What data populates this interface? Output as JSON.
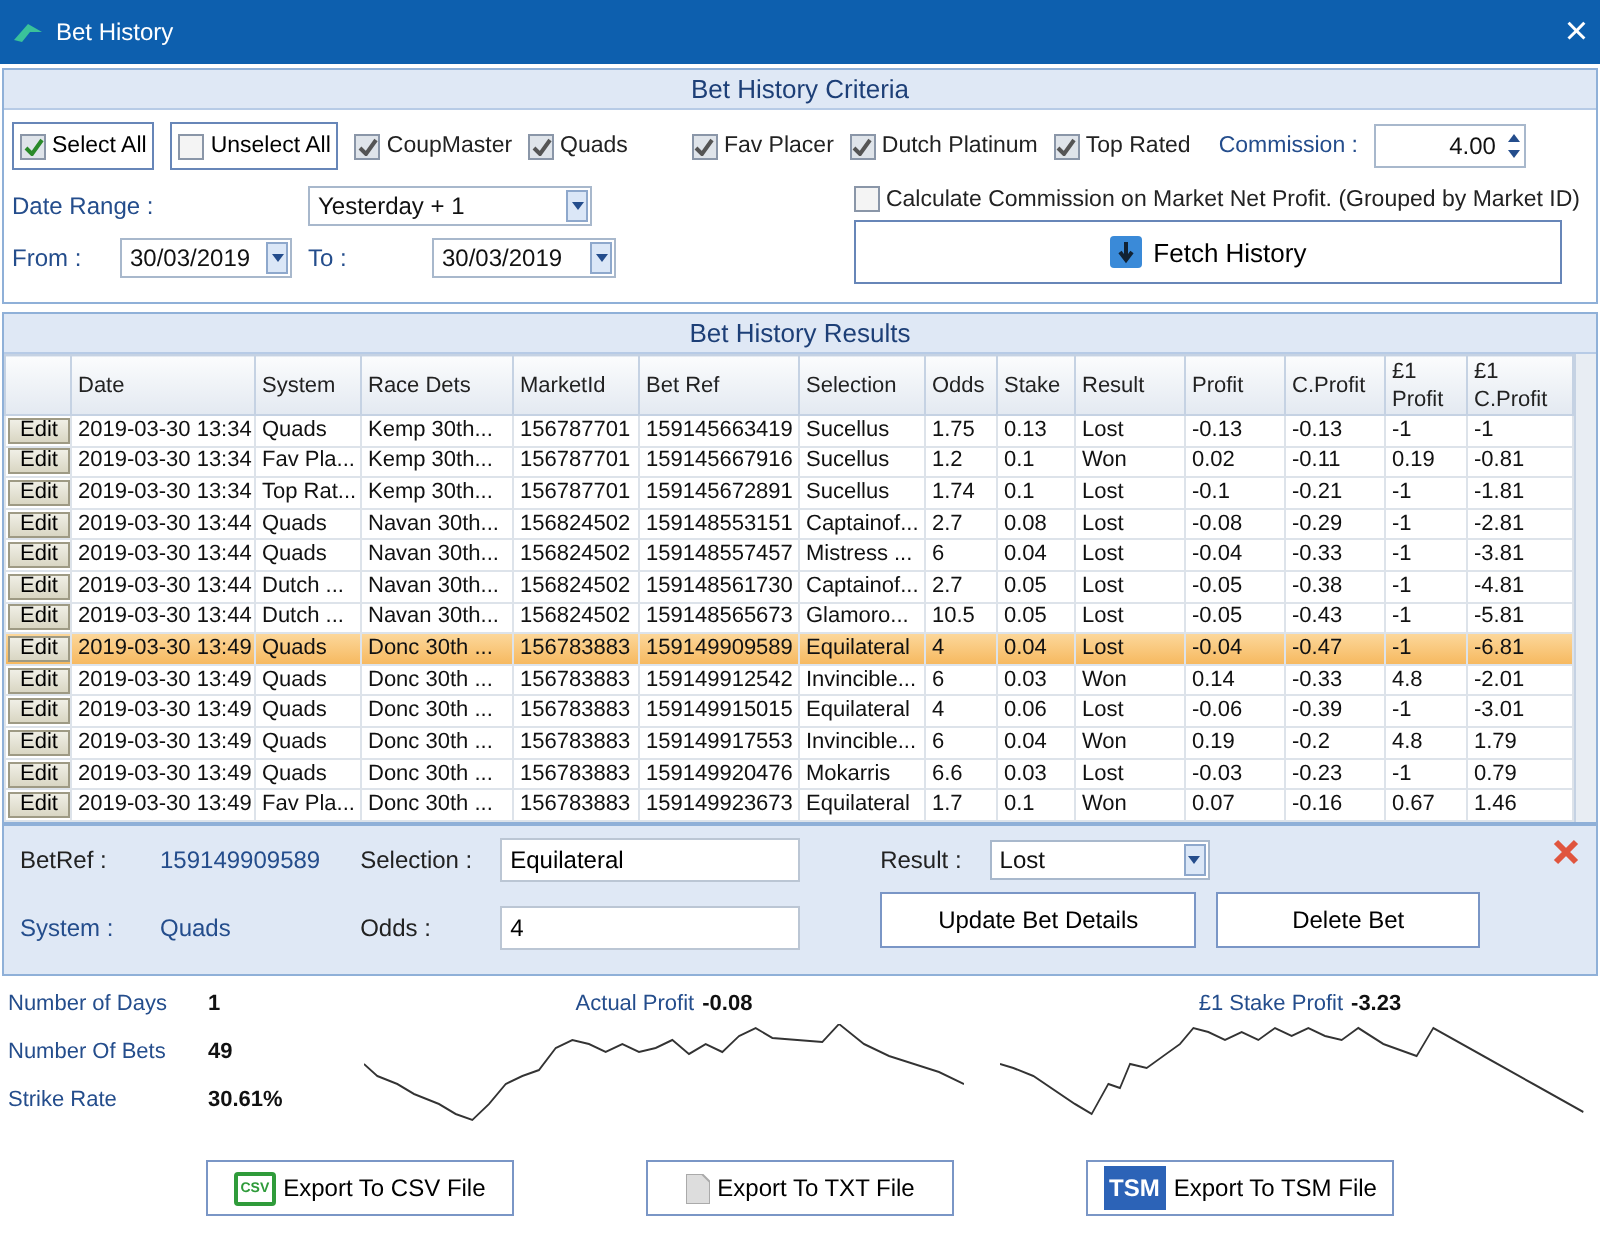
{
  "window": {
    "title": "Bet History",
    "close": "×"
  },
  "criteria": {
    "title": "Bet History Criteria",
    "select_buttons": [
      {
        "label": "Select All",
        "checked": true
      },
      {
        "label": "Unselect All",
        "checked": false
      }
    ],
    "systems": [
      {
        "label": "CoupMaster",
        "checked": true
      },
      {
        "label": "Quads",
        "checked": true
      },
      {
        "label": "Fav Placer",
        "checked": true
      },
      {
        "label": "Dutch Platinum",
        "checked": true
      },
      {
        "label": "Top Rated",
        "checked": true
      }
    ],
    "commission_label": "Commission :",
    "commission": "4.00",
    "date_range_label": "Date Range :",
    "date_range": "Yesterday + 1",
    "from_label": "From :",
    "from": "30/03/2019",
    "to_label": "To :",
    "to": "30/03/2019",
    "calc_commission": {
      "label": "Calculate Commission on Market Net Profit. (Grouped by Market ID)",
      "checked": false
    },
    "fetch_button": "Fetch History"
  },
  "results": {
    "title": "Bet History Results",
    "columns": [
      "Date",
      "System",
      "Race Dets",
      "MarketId",
      "Bet Ref",
      "Selection",
      "Odds",
      "Stake",
      "Result",
      "Profit",
      "C.Profit",
      "£1 Profit",
      "£1 C.Profit"
    ],
    "rows": [
      {
        "edit": "Edit",
        "cells": [
          "2019-03-30 13:34",
          "Quads",
          "Kemp  30th...",
          "156787701",
          "159145663419",
          "Sucellus",
          "1.75",
          "0.13",
          "Lost",
          "-0.13",
          "-0.13",
          "-1",
          "-1"
        ],
        "selected": false
      },
      {
        "edit": "Edit",
        "cells": [
          "2019-03-30 13:34",
          "Fav Pla...",
          "Kemp  30th...",
          "156787701",
          "159145667916",
          "Sucellus",
          "1.2",
          "0.1",
          "Won",
          "0.02",
          "-0.11",
          "0.19",
          "-0.81"
        ],
        "selected": false
      },
      {
        "edit": "Edit",
        "cells": [
          "2019-03-30 13:34",
          "Top Rat...",
          "Kemp  30th...",
          "156787701",
          "159145672891",
          "Sucellus",
          "1.74",
          "0.1",
          "Lost",
          "-0.1",
          "-0.21",
          "-1",
          "-1.81"
        ],
        "selected": false
      },
      {
        "edit": "Edit",
        "cells": [
          "2019-03-30 13:44",
          "Quads",
          "Navan  30th...",
          "156824502",
          "159148553151",
          "Captainof...",
          "2.7",
          "0.08",
          "Lost",
          "-0.08",
          "-0.29",
          "-1",
          "-2.81"
        ],
        "selected": false
      },
      {
        "edit": "Edit",
        "cells": [
          "2019-03-30 13:44",
          "Quads",
          "Navan  30th...",
          "156824502",
          "159148557457",
          "Mistress ...",
          "6",
          "0.04",
          "Lost",
          "-0.04",
          "-0.33",
          "-1",
          "-3.81"
        ],
        "selected": false
      },
      {
        "edit": "Edit",
        "cells": [
          "2019-03-30 13:44",
          "Dutch ...",
          "Navan  30th...",
          "156824502",
          "159148561730",
          "Captainof...",
          "2.7",
          "0.05",
          "Lost",
          "-0.05",
          "-0.38",
          "-1",
          "-4.81"
        ],
        "selected": false
      },
      {
        "edit": "Edit",
        "cells": [
          "2019-03-30 13:44",
          "Dutch ...",
          "Navan  30th...",
          "156824502",
          "159148565673",
          "Glamoro...",
          "10.5",
          "0.05",
          "Lost",
          "-0.05",
          "-0.43",
          "-1",
          "-5.81"
        ],
        "selected": false
      },
      {
        "edit": "Edit",
        "cells": [
          "2019-03-30 13:49",
          "Quads",
          "Donc  30th ...",
          "156783883",
          "159149909589",
          "Equilateral",
          "4",
          "0.04",
          "Lost",
          "-0.04",
          "-0.47",
          "-1",
          "-6.81"
        ],
        "selected": true
      },
      {
        "edit": "Edit",
        "cells": [
          "2019-03-30 13:49",
          "Quads",
          "Donc  30th ...",
          "156783883",
          "159149912542",
          "Invincible...",
          "6",
          "0.03",
          "Won",
          "0.14",
          "-0.33",
          "4.8",
          "-2.01"
        ],
        "selected": false
      },
      {
        "edit": "Edit",
        "cells": [
          "2019-03-30 13:49",
          "Quads",
          "Donc  30th ...",
          "156783883",
          "159149915015",
          "Equilateral",
          "4",
          "0.06",
          "Lost",
          "-0.06",
          "-0.39",
          "-1",
          "-3.01"
        ],
        "selected": false
      },
      {
        "edit": "Edit",
        "cells": [
          "2019-03-30 13:49",
          "Quads",
          "Donc  30th ...",
          "156783883",
          "159149917553",
          "Invincible...",
          "6",
          "0.04",
          "Won",
          "0.19",
          "-0.2",
          "4.8",
          "1.79"
        ],
        "selected": false
      },
      {
        "edit": "Edit",
        "cells": [
          "2019-03-30 13:49",
          "Quads",
          "Donc  30th ...",
          "156783883",
          "159149920476",
          "Mokarris",
          "6.6",
          "0.03",
          "Lost",
          "-0.03",
          "-0.23",
          "-1",
          "0.79"
        ],
        "selected": false
      },
      {
        "edit": "Edit",
        "cells": [
          "2019-03-30 13:49",
          "Fav Pla...",
          "Donc  30th ...",
          "156783883",
          "159149923673",
          "Equilateral",
          "1.7",
          "0.1",
          "Won",
          "0.07",
          "-0.16",
          "0.67",
          "1.46"
        ],
        "selected": false
      }
    ]
  },
  "edit_panel": {
    "betref_label": "BetRef :",
    "betref": "159149909589",
    "system_label": "System :",
    "system": "Quads",
    "selection_label": "Selection :",
    "selection": "Equilateral",
    "odds_label": "Odds :",
    "odds": "4",
    "result_label": "Result :",
    "result": "Lost",
    "update_button": "Update Bet Details",
    "delete_button": "Delete Bet"
  },
  "stats": [
    {
      "label": "Number of Days",
      "value": "1"
    },
    {
      "label": "Number Of Bets",
      "value": "49"
    },
    {
      "label": "Strike Rate",
      "value": "30.61%"
    }
  ],
  "profit_charts": [
    {
      "label": "Actual Profit",
      "value": "-0.08"
    },
    {
      "label": "£1 Stake Profit",
      "value": "-3.23"
    }
  ],
  "exports": [
    {
      "kind": "csv",
      "label": "Export To CSV File",
      "icon_text": "CSV"
    },
    {
      "kind": "txt",
      "label": "Export To TXT File"
    },
    {
      "kind": "tsm",
      "label": "Export To TSM File",
      "icon_text": "TSM"
    }
  ]
}
